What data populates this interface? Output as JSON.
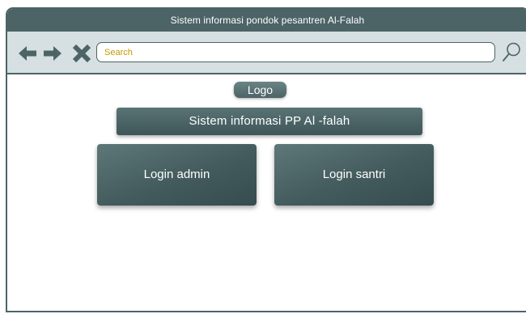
{
  "window": {
    "title": "Sistem informasi pondok pesantren Al-Falah"
  },
  "toolbar": {
    "back_icon": "arrow-left-icon",
    "forward_icon": "arrow-right-icon",
    "close_icon": "close-x-icon",
    "search_placeholder": "Search",
    "search_icon": "magnifier-icon"
  },
  "main": {
    "logo_label": "Logo",
    "app_title": "Sistem informasi PP Al -falah",
    "login_admin_label": "Login admin",
    "login_santri_label": "Login santri"
  },
  "colors": {
    "primary": "#4d6466",
    "toolbar_bg": "#d6dfe1",
    "placeholder": "#c49a00",
    "text_light": "#ffffff"
  }
}
